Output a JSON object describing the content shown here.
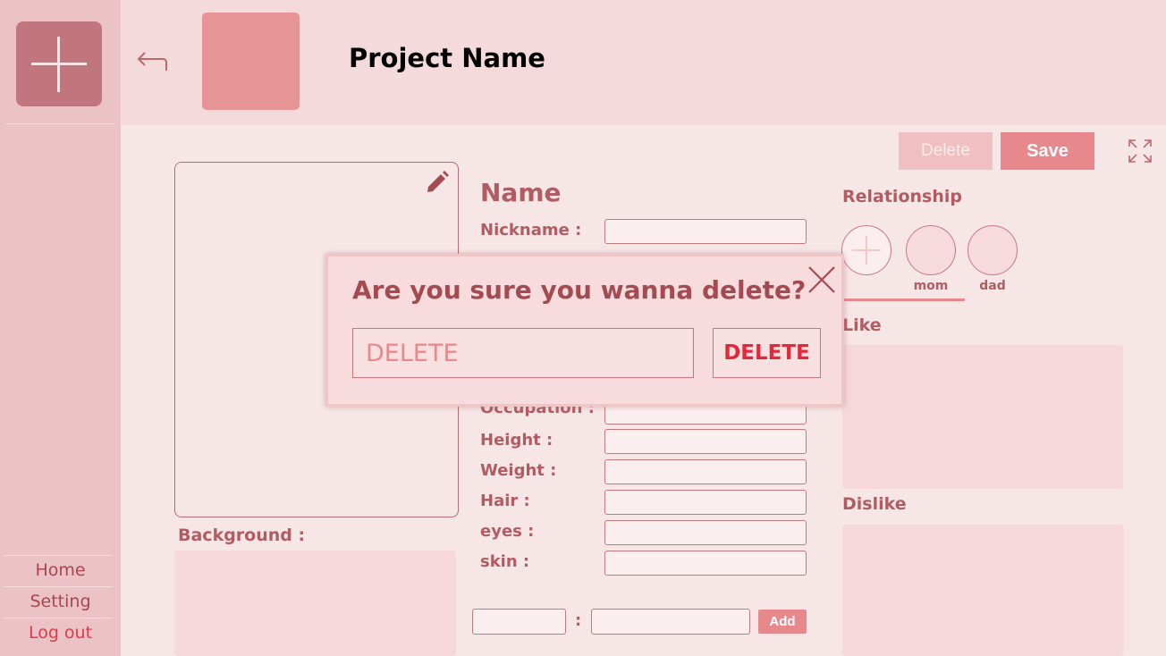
{
  "sidebar": {
    "items": [
      {
        "label": "Home"
      },
      {
        "label": "Setting"
      },
      {
        "label": "Log out"
      }
    ]
  },
  "header": {
    "title": "Project Name"
  },
  "toolbar": {
    "delete_label": "Delete",
    "save_label": "Save"
  },
  "character": {
    "name_heading": "Name",
    "background_label": "Background :",
    "fields": [
      {
        "label": "Nickname :"
      },
      {
        "label": "Occupation :"
      },
      {
        "label": "Height :"
      },
      {
        "label": "Weight :"
      },
      {
        "label": "Hair :"
      },
      {
        "label": "eyes :"
      },
      {
        "label": "skin :"
      }
    ],
    "custom_separator": ":",
    "add_label": "Add"
  },
  "relationship": {
    "heading": "Relationship",
    "people": [
      {
        "name": "mom"
      },
      {
        "name": "dad"
      }
    ]
  },
  "like": {
    "heading": "Like"
  },
  "dislike": {
    "heading": "Dislike"
  },
  "modal": {
    "title": "Are you sure you wanna delete?",
    "input_placeholder": "DELETE",
    "confirm_label": "DELETE"
  },
  "colors": {
    "sidebar_bg": "#ebc3c6",
    "accent": "#e7888d",
    "danger": "#de2a3a",
    "text": "#b05c62"
  }
}
